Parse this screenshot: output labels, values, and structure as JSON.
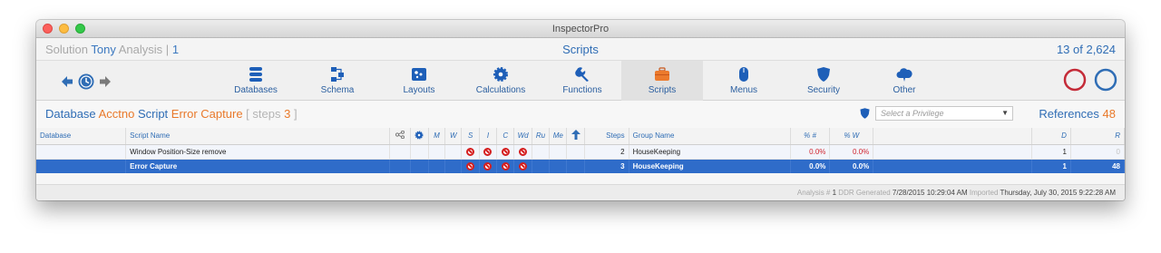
{
  "window": {
    "title": "InspectorPro"
  },
  "header": {
    "solution_label": "Solution",
    "solution_name": "Tony",
    "analysis_name": "Analysis",
    "separator": "|",
    "analysis_number": "1",
    "section_title": "Scripts",
    "record_count": "13 of 2,624"
  },
  "toolbar": {
    "items": [
      {
        "label": "Databases",
        "icon": "database-icon"
      },
      {
        "label": "Schema",
        "icon": "schema-icon"
      },
      {
        "label": "Layouts",
        "icon": "layouts-icon"
      },
      {
        "label": "Calculations",
        "icon": "gear-icon"
      },
      {
        "label": "Functions",
        "icon": "wrench-icon"
      },
      {
        "label": "Scripts",
        "icon": "briefcase-icon",
        "active": true
      },
      {
        "label": "Menus",
        "icon": "mouse-icon"
      },
      {
        "label": "Security",
        "icon": "shield-icon"
      },
      {
        "label": "Other",
        "icon": "cloud-icon"
      }
    ]
  },
  "subheader": {
    "database_label": "Database",
    "database_name": "Acctno",
    "script_label": "Script",
    "script_name": "Error Capture",
    "steps_open": "[ steps",
    "steps_count": "3",
    "steps_close": "]",
    "privilege_placeholder": "Select a Privilege",
    "references_label": "References",
    "references_count": "48"
  },
  "table": {
    "columns": [
      "Database",
      "Script Name",
      "M",
      "W",
      "S",
      "I",
      "C",
      "Wd",
      "Ru",
      "Me",
      "Steps",
      "Group Name",
      "% #",
      "% W",
      "D",
      "R"
    ],
    "rows": [
      {
        "database": "",
        "script_name": "Window Position-Size remove",
        "steps": "2",
        "group": "HouseKeeping",
        "pct_num": "0.0%",
        "pct_w": "0.0%",
        "d": "1",
        "r": "0",
        "selected": false
      },
      {
        "database": "",
        "script_name": "Error Capture",
        "steps": "3",
        "group": "HouseKeeping",
        "pct_num": "0.0%",
        "pct_w": "0.0%",
        "d": "1",
        "r": "48",
        "selected": true
      }
    ]
  },
  "footer": {
    "analysis_label": "Analysis #",
    "analysis_value": "1",
    "ddr_label": "DDR Generated",
    "ddr_value": "7/28/2015  10:29:04 AM",
    "imported_label": "Imported",
    "imported_value": "Thursday, July 30, 2015 9:22:28 AM"
  },
  "colors": {
    "accent": "#2f6db5",
    "highlight": "#e9792a",
    "selection": "#2f6cc9",
    "warning": "#d52020"
  }
}
